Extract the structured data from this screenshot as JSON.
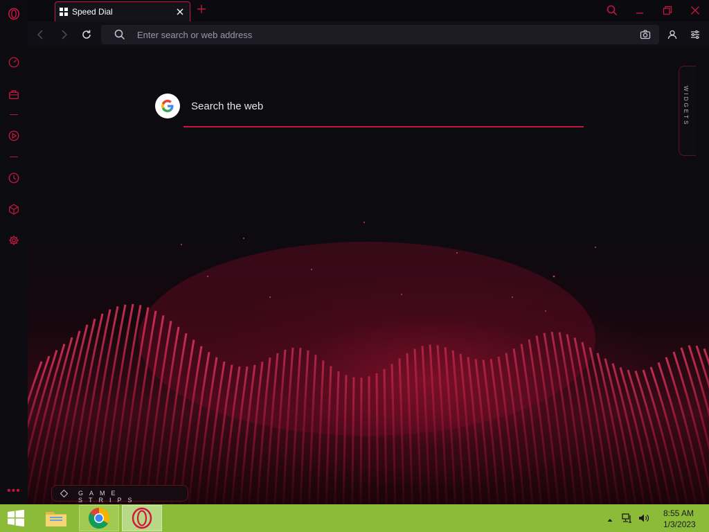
{
  "browser": {
    "tab": {
      "title": "Speed Dial"
    },
    "address_bar": {
      "placeholder": "Enter search or web address",
      "value": ""
    }
  },
  "speed_dial": {
    "search": {
      "placeholder": "Search the web"
    },
    "widgets_label": "WIDGETS",
    "game_strips_label": "GAME STRIPS"
  },
  "sidebar": {
    "items": [
      "speed-dial-icon",
      "workspaces-icon",
      "player-icon",
      "history-icon",
      "extensions-icon",
      "settings-icon"
    ],
    "more": "•••"
  },
  "taskbar": {
    "clock": {
      "time": "8:55 AM",
      "date": "1/3/2023"
    },
    "apps": [
      "file-explorer",
      "chrome",
      "opera-gx"
    ]
  },
  "colors": {
    "accent": "#c4163f",
    "background": "#0a0a0e",
    "taskbar": "#8bbb38"
  }
}
